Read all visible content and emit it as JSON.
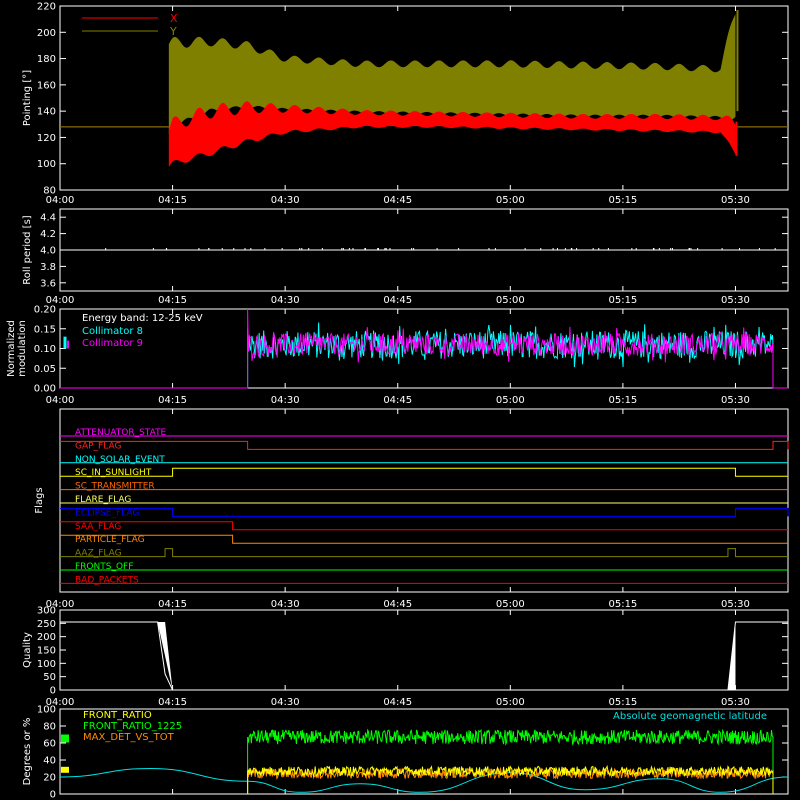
{
  "chart_data": [
    {
      "type": "line",
      "ylabel": "Pointing [°]",
      "ylim": [
        80,
        220
      ],
      "yticks": [
        80,
        100,
        120,
        140,
        160,
        180,
        200,
        220
      ],
      "legend_position": "top-left",
      "series": [
        {
          "name": "X",
          "color": "#ff0000",
          "baseline": 128,
          "active_range": [
            "04:14",
            "05:30"
          ],
          "x": [
            "04:14",
            "04:15",
            "04:20",
            "04:25",
            "04:30",
            "04:40",
            "04:50",
            "05:00",
            "05:10",
            "05:20",
            "05:28",
            "05:30"
          ],
          "lower": [
            95,
            100,
            108,
            117,
            124,
            128,
            128,
            127,
            126,
            125,
            124,
            108
          ],
          "upper": [
            120,
            130,
            140,
            143,
            142,
            139,
            138,
            137,
            136,
            136,
            135,
            132
          ]
        },
        {
          "name": "Y",
          "color": "#808000",
          "baseline": 128,
          "active_range": [
            "04:14",
            "05:30"
          ],
          "x": [
            "04:14",
            "04:15",
            "04:20",
            "04:25",
            "04:30",
            "04:40",
            "04:50",
            "05:00",
            "05:10",
            "05:20",
            "05:28",
            "05:30"
          ],
          "lower": [
            118,
            128,
            140,
            143,
            141,
            139,
            138,
            137,
            136,
            136,
            135,
            134
          ],
          "upper": [
            190,
            192,
            193,
            190,
            180,
            176,
            176,
            176,
            175,
            174,
            172,
            217
          ]
        }
      ],
      "xticks": [
        "04:00",
        "04:15",
        "04:30",
        "04:45",
        "05:00",
        "05:15",
        "05:30"
      ]
    },
    {
      "type": "line",
      "ylabel": "Roll period [s]",
      "ylim": [
        3.5,
        4.5
      ],
      "yticks": [
        "3.6",
        "3.8",
        "4.0",
        "4.2",
        "4.4"
      ],
      "series": [
        {
          "name": "",
          "color": "#ffffff",
          "value": 4.0
        }
      ],
      "xticks": [
        "04:00",
        "04:15",
        "04:30",
        "04:45",
        "05:00",
        "05:15",
        "05:30"
      ]
    },
    {
      "type": "line",
      "ylabel": "Normalized modulation",
      "ylim": [
        0,
        0.2
      ],
      "yticks": [
        "0.00",
        "0.05",
        "0.10",
        "0.15",
        "0.20"
      ],
      "annotation": "Energy band: 12-25 keV",
      "active_range": [
        "04:25",
        "05:35"
      ],
      "series": [
        {
          "name": "Collimator 8",
          "color": "#00ffff",
          "mean": 0.11,
          "range": [
            0.08,
            0.17
          ]
        },
        {
          "name": "Collimator 9",
          "color": "#ff00ff",
          "mean": 0.11,
          "range": [
            0.08,
            0.15
          ]
        }
      ],
      "xticks": [
        "04:00",
        "04:15",
        "04:30",
        "04:45",
        "05:00",
        "05:15",
        "05:30"
      ]
    },
    {
      "type": "line",
      "ylabel": "Flags",
      "flags": [
        {
          "name": "ATTENUATOR_STATE",
          "color": "#ff00ff",
          "on": []
        },
        {
          "name": "GAP_FLAG",
          "color": "#ff2020",
          "on": [
            [
              "04:00",
              "04:25"
            ],
            [
              "05:35",
              "05:37"
            ]
          ]
        },
        {
          "name": "NON_SOLAR_EVENT",
          "color": "#00ffff",
          "on": []
        },
        {
          "name": "SC_IN_SUNLIGHT",
          "color": "#ffff00",
          "on": [
            [
              "04:15",
              "05:30"
            ]
          ]
        },
        {
          "name": "SC_TRANSMITTER",
          "color": "#ff6600",
          "on": []
        },
        {
          "name": "FLARE_FLAG",
          "color": "#ffff66",
          "on": []
        },
        {
          "name": "ECLIPSE_FLAG",
          "color": "#0000ff",
          "on": [
            [
              "04:00",
              "04:15"
            ],
            [
              "05:30",
              "05:37"
            ]
          ]
        },
        {
          "name": "SAA_FLAG",
          "color": "#ff0000",
          "on": [
            [
              "04:00",
              "04:23"
            ]
          ]
        },
        {
          "name": "PARTICLE_FLAG",
          "color": "#ff8800",
          "on": [
            [
              "04:00",
              "04:23"
            ]
          ]
        },
        {
          "name": "AAZ_FLAG",
          "color": "#808000",
          "on": [
            [
              "04:14",
              "04:15"
            ],
            [
              "05:29",
              "05:30"
            ]
          ]
        },
        {
          "name": "FRONTS_OFF",
          "color": "#00ff00",
          "on": []
        },
        {
          "name": "BAD_PACKETS",
          "color": "#ff0000",
          "on": []
        }
      ],
      "xticks": [
        "04:00",
        "04:15",
        "04:30",
        "04:45",
        "05:00",
        "05:15",
        "05:30"
      ]
    },
    {
      "type": "line",
      "ylabel": "Quality",
      "ylim": [
        0,
        300
      ],
      "yticks": [
        "0",
        "50",
        "100",
        "150",
        "200",
        "250",
        "300"
      ],
      "series": [
        {
          "name": "",
          "color": "#ffffff",
          "x": [
            "04:00",
            "04:13",
            "04:14",
            "04:15",
            "05:29",
            "05:30",
            "05:37"
          ],
          "y": [
            255,
            255,
            60,
            0,
            0,
            255,
            255
          ]
        }
      ],
      "xticks": [
        "04:00",
        "04:15",
        "04:30",
        "04:45",
        "05:00",
        "05:15",
        "05:30"
      ]
    },
    {
      "type": "line",
      "ylabel": "Degrees or %",
      "ylim": [
        0,
        100
      ],
      "yticks": [
        "0",
        "20",
        "40",
        "60",
        "80",
        "100"
      ],
      "active_range": [
        "04:25",
        "05:35"
      ],
      "series": [
        {
          "name": "FRONT_RATIO",
          "color": "#ffff00",
          "mean": 27,
          "range": [
            22,
            33
          ]
        },
        {
          "name": "FRONT_RATIO_1225",
          "color": "#00ff00",
          "mean": 67,
          "range": [
            58,
            75
          ]
        },
        {
          "name": "MAX_DET_VS_TOT",
          "color": "#ff8c00",
          "mean": 24,
          "range": [
            18,
            30
          ]
        },
        {
          "name": "Absolute geomagnetic latitude",
          "color": "#00e0e0",
          "x": [
            "04:00",
            "04:12",
            "04:25",
            "04:32",
            "04:40",
            "04:48",
            "05:00",
            "05:10",
            "05:20",
            "05:28",
            "05:37"
          ],
          "y": [
            20,
            30,
            15,
            2,
            12,
            2,
            25,
            5,
            18,
            2,
            20
          ]
        }
      ]
    }
  ]
}
